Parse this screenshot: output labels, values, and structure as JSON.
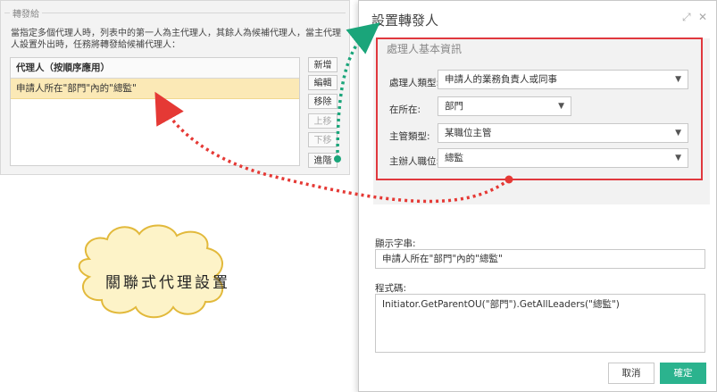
{
  "left_panel": {
    "legend": "轉發給",
    "description": "當指定多個代理人時，列表中的第一人為主代理人，其餘人為候補代理人，當主代理人設置外出時，任務將轉發給候補代理人：",
    "list_header": "代理人（按順序應用）",
    "rows": [
      "申請人所在\"部門\"內的\"總監\""
    ],
    "buttons": {
      "add": "新增",
      "edit": "編輯",
      "remove": "移除",
      "move_up": "上移",
      "move_down": "下移",
      "advanced": "進階"
    }
  },
  "dialog": {
    "title": "設置轉發人",
    "section_title": "處理人基本資訊",
    "fields": {
      "handler_type": {
        "label": "處理人類型:",
        "value": "申請人的業務負責人或同事"
      },
      "located_in": {
        "label": "在所在:",
        "value": "部門"
      },
      "supervisor_type": {
        "label": "主管類型:",
        "value": "某職位主管"
      },
      "supervisor_position": {
        "label": "主辦人職位:",
        "value": "總監"
      }
    },
    "display_text": {
      "label": "顯示字串:",
      "value": "申請人所在\"部門\"內的\"總監\""
    },
    "code": {
      "label": "程式碼:",
      "value": "Initiator.GetParentOU(\"部門\").GetAllLeaders(\"總監\")"
    },
    "buttons": {
      "cancel": "取消",
      "ok": "確定"
    },
    "colors": {
      "ok_button": "#2bb38e",
      "highlight_frame": "#e0383e"
    }
  },
  "callout": {
    "text": "關聯式代理設置",
    "colors": {
      "cloud_fill": "#fdf3c8",
      "cloud_stroke": "#e2b93b",
      "red_arrow": "#e53935",
      "green_arrow": "#1aa57a"
    }
  }
}
